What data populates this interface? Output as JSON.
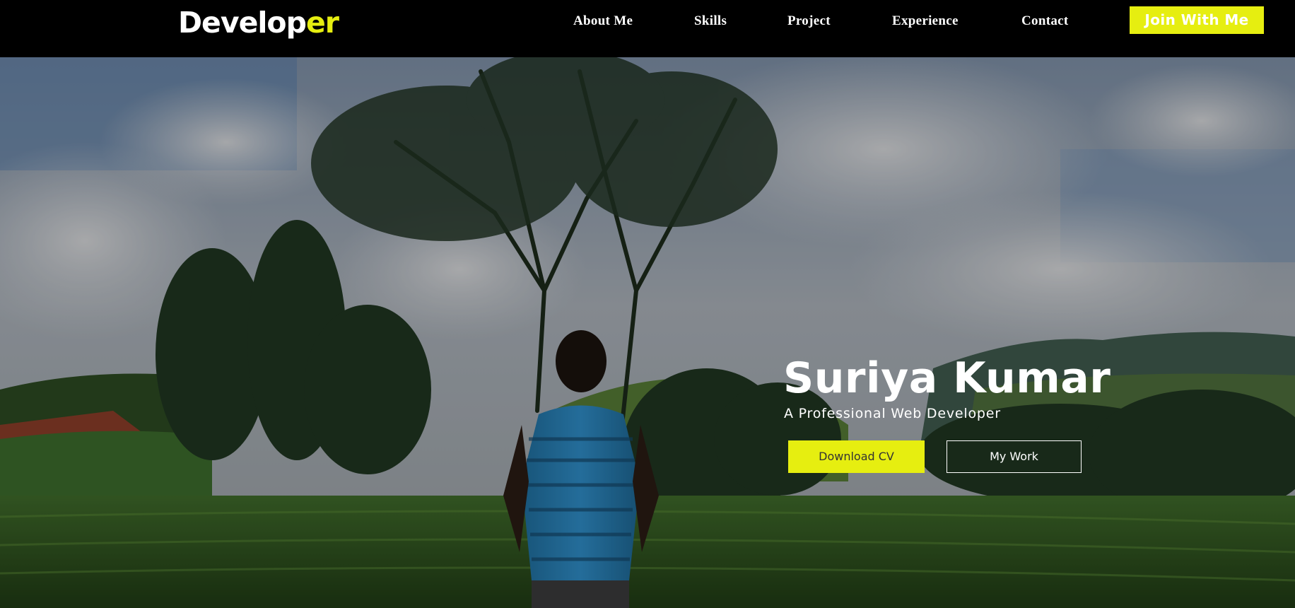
{
  "navbar": {
    "logo_main": "Develop",
    "logo_accent": "er",
    "links": [
      "About Me",
      "Skills",
      "Project",
      "Experience",
      "Contact"
    ],
    "cta_label": "Join With Me"
  },
  "hero": {
    "name": "Suriya Kumar",
    "tagline": "A Professional Web Developer",
    "primary_button": "Download CV",
    "secondary_button": "My Work",
    "image_description": "person in blue striped t-shirt standing in tea plantation facing tall trees under cloudy sky"
  },
  "colors": {
    "accent": "#e6ee10",
    "navbar_bg": "#000000",
    "text": "#ffffff"
  }
}
